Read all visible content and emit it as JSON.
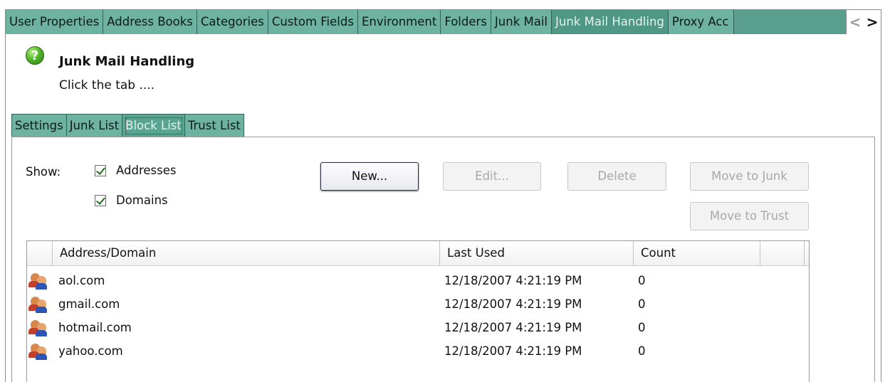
{
  "top_tabs": [
    "User Properties",
    "Address Books",
    "Categories",
    "Custom Fields",
    "Environment",
    "Folders",
    "Junk Mail",
    "Junk Mail Handling",
    "Proxy Acc"
  ],
  "top_tabs_active": "Junk Mail Handling",
  "scroll": {
    "left": "<",
    "right": ">"
  },
  "header": {
    "title": "Junk Mail Handling",
    "description": "Click the tab ....",
    "icon": "help-icon"
  },
  "sub_tabs": [
    "Settings",
    "Junk List",
    "Block List",
    "Trust List"
  ],
  "sub_tabs_active": "Block List",
  "show": {
    "label": "Show:",
    "addresses": {
      "label": "Addresses",
      "checked": true
    },
    "domains": {
      "label": "Domains",
      "checked": true
    }
  },
  "buttons": {
    "new": "New...",
    "edit": "Edit...",
    "delete": "Delete",
    "move_to_junk": "Move to Junk",
    "move_to_trust": "Move to Trust"
  },
  "list": {
    "columns": [
      "Address/Domain",
      "Last Used",
      "Count"
    ],
    "rows": [
      {
        "address": "aol.com",
        "last_used": "12/18/2007 4:21:19 PM",
        "count": "0",
        "icon": "users-icon"
      },
      {
        "address": "gmail.com",
        "last_used": "12/18/2007 4:21:19 PM",
        "count": "0",
        "icon": "users-icon"
      },
      {
        "address": "hotmail.com",
        "last_used": "12/18/2007 4:21:19 PM",
        "count": "0",
        "icon": "users-icon"
      },
      {
        "address": "yahoo.com",
        "last_used": "12/18/2007 4:21:19 PM",
        "count": "0",
        "icon": "users-icon"
      }
    ]
  },
  "colors": {
    "tab_bg": "#6eb3a1",
    "tab_active_bg": "#4f9886"
  }
}
